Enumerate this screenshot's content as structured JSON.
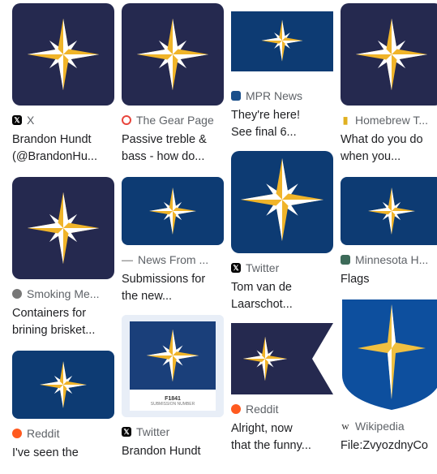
{
  "colors": {
    "navy": "#25294f",
    "flag_blue": "#0d3b73",
    "gold": "#f0b429",
    "white": "#ffffff",
    "light_blue": "#e8eef7"
  },
  "results": {
    "c1": [
      {
        "source": "X",
        "icon": "x-logo-icon",
        "title_line1": "Brandon Hundt",
        "title_line2": "(@BrandonHu..."
      },
      {
        "source": "Smoking Me...",
        "icon": "smoking-meat-icon",
        "title_line1": "Containers for",
        "title_line2": "brining brisket..."
      },
      {
        "source": "Reddit",
        "icon": "reddit-icon",
        "title_line1": "I've seen the"
      }
    ],
    "c2": [
      {
        "source": "The Gear Page",
        "icon": "gear-page-icon",
        "title_line1": "Passive treble &",
        "title_line2": "bass - how do..."
      },
      {
        "source": "News From ...",
        "icon": "news-icon",
        "title_line1": "Submissions for",
        "title_line2": "the new..."
      },
      {
        "source": "Twitter",
        "icon": "x-logo-icon",
        "title_line1": "Brandon Hundt",
        "caption1": "F1841",
        "caption2": "SUBMISSION NUMBER"
      }
    ],
    "c3": [
      {
        "source": "MPR News",
        "icon": "mpr-news-icon",
        "title_line1": "They're here!",
        "title_line2": "See final 6..."
      },
      {
        "source": "Twitter",
        "icon": "x-logo-icon",
        "title_line1": "Tom van de",
        "title_line2": "Laarschot..."
      },
      {
        "source": "Reddit",
        "icon": "reddit-icon",
        "title_line1": "Alright, now",
        "title_line2": "that the funny..."
      }
    ],
    "c4": [
      {
        "source": "Homebrew T...",
        "icon": "homebrew-icon",
        "title_line1": "What do you do",
        "title_line2": "when you..."
      },
      {
        "source": "Minnesota H...",
        "icon": "minnesota-historical-icon",
        "title_line1": "Flags"
      },
      {
        "source": "Wikipedia",
        "icon": "wikipedia-icon",
        "title_line1": "File:ZvyozdnyCo"
      }
    ]
  }
}
